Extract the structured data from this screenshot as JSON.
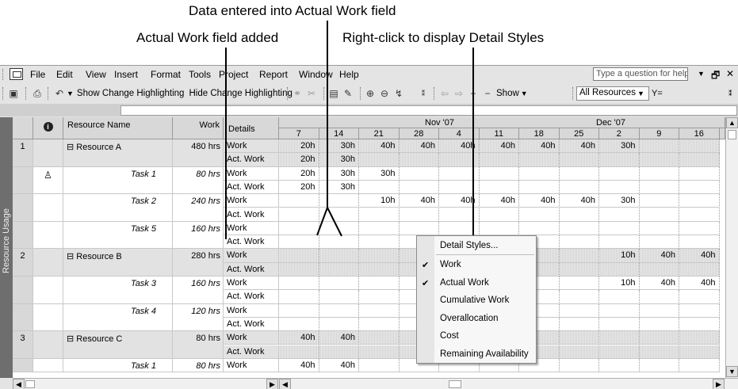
{
  "callouts": {
    "data_entered": "Data entered into Actual Work field",
    "field_added": "Actual Work field added",
    "right_click": "Right-click to display Detail Styles"
  },
  "menubar": {
    "items": [
      "File",
      "Edit",
      "View",
      "Insert",
      "Format",
      "Tools",
      "Project",
      "Report",
      "Window",
      "Help"
    ],
    "help_placeholder": "Type a question for help"
  },
  "toolbar": {
    "show_change": "Show Change Highlighting",
    "hide_change": "Hide Change Highlighting",
    "show_label": "Show",
    "filter_value": "All Resources",
    "autofilter_icon": "Y="
  },
  "view_bar_label": "Resource Usage",
  "sheet": {
    "headers": {
      "name": "Resource Name",
      "work": "Work",
      "details": "Details"
    },
    "rows": [
      {
        "id": "1",
        "name": "⊟ Resource A",
        "work": "480 hrs",
        "details": [
          "Work",
          "Act. Work"
        ],
        "resource": true
      },
      {
        "id": "",
        "name": "Task 1",
        "work": "80 hrs",
        "details": [
          "Work",
          "Act. Work"
        ],
        "resource": false,
        "indicator": true
      },
      {
        "id": "",
        "name": "Task 2",
        "work": "240 hrs",
        "details": [
          "Work",
          "Act. Work"
        ],
        "resource": false
      },
      {
        "id": "",
        "name": "Task 5",
        "work": "160 hrs",
        "details": [
          "Work",
          "Act. Work"
        ],
        "resource": false
      },
      {
        "id": "2",
        "name": "⊟ Resource B",
        "work": "280 hrs",
        "details": [
          "Work",
          "Act. Work"
        ],
        "resource": true
      },
      {
        "id": "",
        "name": "Task 3",
        "work": "160 hrs",
        "details": [
          "Work",
          "Act. Work"
        ],
        "resource": false
      },
      {
        "id": "",
        "name": "Task 4",
        "work": "120 hrs",
        "details": [
          "Work",
          "Act. Work"
        ],
        "resource": false
      },
      {
        "id": "3",
        "name": "⊟ Resource C",
        "work": "80 hrs",
        "details": [
          "Work",
          "Act. Work"
        ],
        "resource": true
      },
      {
        "id": "",
        "name": "Task 1",
        "work": "80 hrs",
        "details": [
          "Work"
        ],
        "resource": false
      }
    ]
  },
  "timescale": {
    "months": [
      "Nov '07",
      "Dec '07"
    ],
    "days": [
      "7",
      "14",
      "21",
      "28",
      "4",
      "11",
      "18",
      "25",
      "2",
      "9",
      "16"
    ],
    "lines": [
      [
        "20h",
        "30h",
        "40h",
        "40h",
        "40h",
        "40h",
        "40h",
        "40h",
        "30h",
        "",
        ""
      ],
      [
        "20h",
        "30h",
        "",
        "",
        "",
        "",
        "",
        "",
        "",
        "",
        ""
      ],
      [
        "20h",
        "30h",
        "30h",
        "",
        "",
        "",
        "",
        "",
        "",
        "",
        ""
      ],
      [
        "20h",
        "30h",
        "",
        "",
        "",
        "",
        "",
        "",
        "",
        "",
        ""
      ],
      [
        "",
        "",
        "10h",
        "40h",
        "40h",
        "40h",
        "40h",
        "40h",
        "30h",
        "",
        ""
      ],
      [
        "",
        "",
        "",
        "",
        "",
        "",
        "",
        "",
        "",
        "",
        ""
      ],
      [
        "",
        "",
        "",
        "",
        "",
        "",
        "",
        "",
        "",
        "",
        ""
      ],
      [
        "",
        "",
        "",
        "",
        "",
        "",
        "",
        "",
        "",
        "",
        ""
      ],
      [
        "",
        "",
        "",
        "",
        "",
        "",
        "",
        "",
        "10h",
        "40h",
        "40h"
      ],
      [
        "",
        "",
        "",
        "",
        "",
        "",
        "",
        "",
        "",
        "",
        ""
      ],
      [
        "",
        "",
        "",
        "",
        "",
        "",
        "",
        "",
        "10h",
        "40h",
        "40h"
      ],
      [
        "",
        "",
        "",
        "",
        "",
        "",
        "",
        "",
        "",
        "",
        ""
      ],
      [
        "",
        "",
        "",
        "",
        "",
        "",
        "",
        "",
        "",
        "",
        ""
      ],
      [
        "",
        "",
        "",
        "",
        "",
        "",
        "",
        "",
        "",
        "",
        ""
      ],
      [
        "40h",
        "40h",
        "",
        "",
        "",
        "",
        "",
        "",
        "",
        "",
        ""
      ],
      [
        "",
        "",
        "",
        "",
        "",
        "",
        "",
        "",
        "",
        "",
        ""
      ],
      [
        "40h",
        "40h",
        "",
        "",
        "",
        "",
        "",
        "",
        "",
        "",
        ""
      ]
    ]
  },
  "context_menu": {
    "items": [
      {
        "label": "Detail Styles...",
        "checked": false
      },
      {
        "label": "Work",
        "checked": true
      },
      {
        "label": "Actual Work",
        "checked": true
      },
      {
        "label": "Cumulative Work",
        "checked": false
      },
      {
        "label": "Overallocation",
        "checked": false
      },
      {
        "label": "Cost",
        "checked": false
      },
      {
        "label": "Remaining Availability",
        "checked": false
      }
    ]
  }
}
